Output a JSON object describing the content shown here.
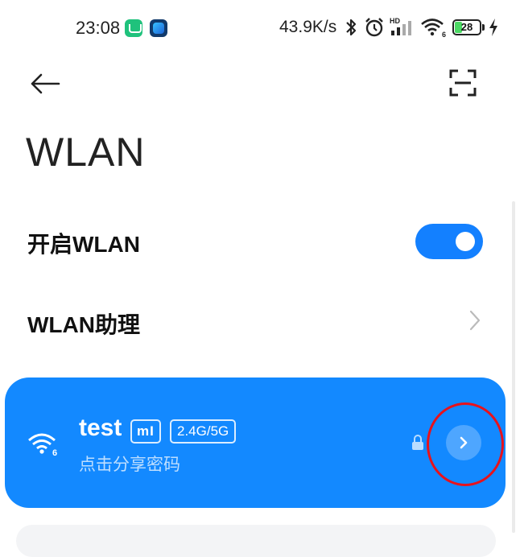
{
  "status_bar": {
    "time": "23:08",
    "network_speed": "43.9K/s",
    "battery_percent": "28",
    "battery_level": 0.28,
    "icons": [
      "mi-home-app-icon",
      "app-icon",
      "bluetooth-icon",
      "alarm-icon",
      "hd-signal-icon",
      "wifi-signal-icon",
      "battery-icon",
      "charging-icon"
    ]
  },
  "header": {
    "back_icon": "arrow-left-icon",
    "scan_icon": "qr-scan-icon",
    "title": "WLAN"
  },
  "settings": {
    "wlan_toggle": {
      "label": "开启WLAN",
      "enabled": true
    },
    "wlan_assistant": {
      "label": "WLAN助理"
    }
  },
  "connected_network": {
    "ssid": "test",
    "mi_badge": "mI",
    "band": "2.4G/5G",
    "subtitle": "点击分享密码",
    "wifi_standard_badge": "6",
    "locked": true,
    "detail_icon": "chevron-right-icon"
  },
  "colors": {
    "accent": "#1389ff",
    "toggle_on": "#1380ff",
    "highlight": "#e8121c"
  }
}
